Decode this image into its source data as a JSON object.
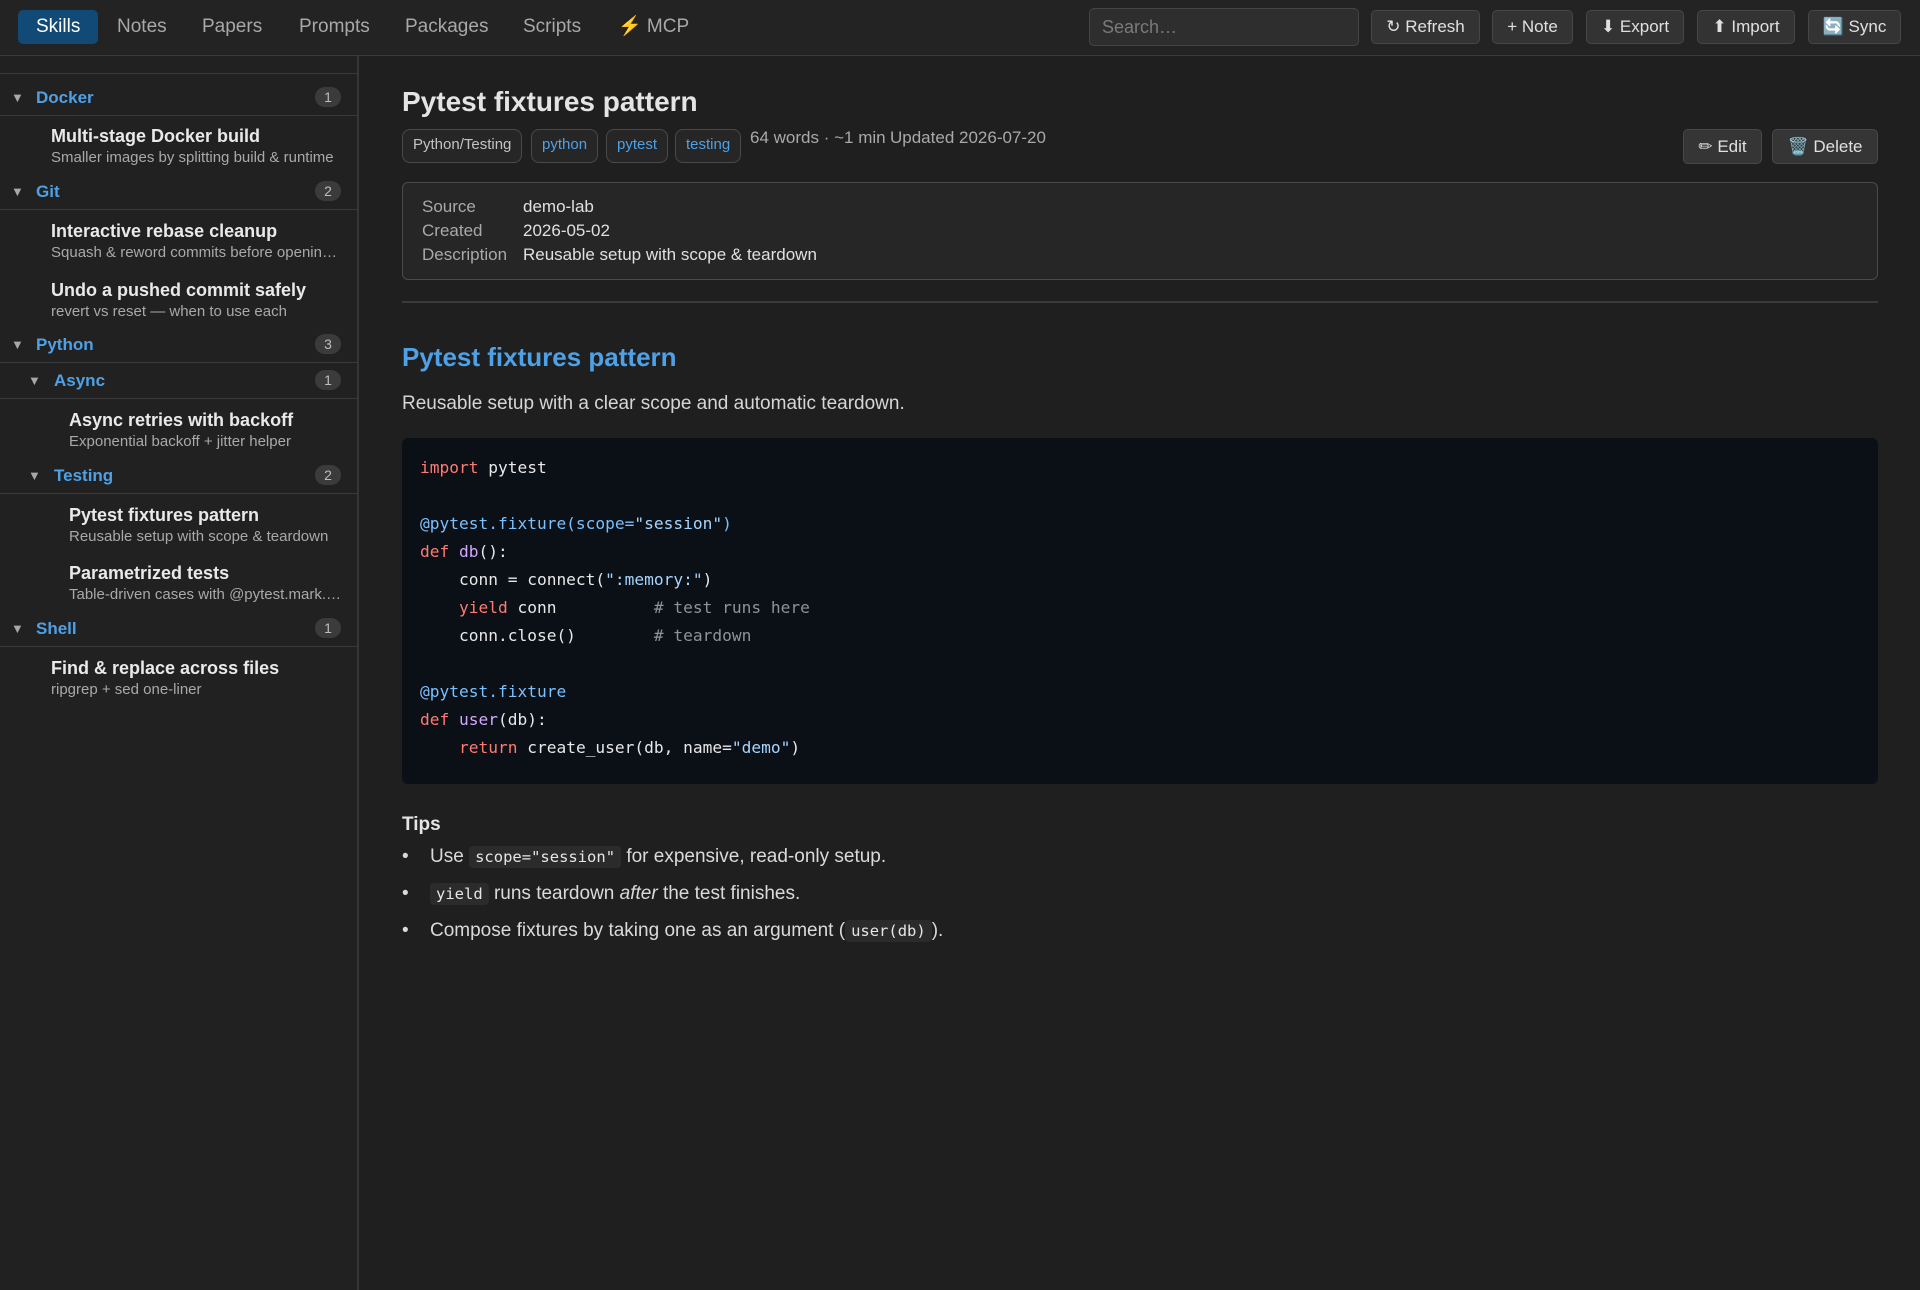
{
  "nav": {
    "tabs": [
      {
        "label": "Skills",
        "active": true
      },
      {
        "label": "Notes",
        "active": false
      },
      {
        "label": "Papers",
        "active": false
      },
      {
        "label": "Prompts",
        "active": false
      },
      {
        "label": "Packages",
        "active": false
      },
      {
        "label": "Scripts",
        "active": false
      },
      {
        "label": "⚡ MCP",
        "active": false
      }
    ],
    "search_placeholder": "Search…",
    "actions": {
      "refresh": "↻ Refresh",
      "note": "+ Note",
      "export": "⬇ Export",
      "import": "⬆ Import",
      "sync": "🔄 Sync"
    }
  },
  "sidebar": {
    "groups": {
      "docker": {
        "name": "Docker",
        "count": "1"
      },
      "git": {
        "name": "Git",
        "count": "2"
      },
      "python": {
        "name": "Python",
        "count": "3"
      },
      "async": {
        "name": "Async",
        "count": "1"
      },
      "testing": {
        "name": "Testing",
        "count": "2"
      },
      "shell": {
        "name": "Shell",
        "count": "1"
      }
    },
    "items": {
      "docker_build": {
        "title": "Multi-stage Docker build",
        "subtitle": "Smaller images by splitting build & runtime"
      },
      "rebase": {
        "title": "Interactive rebase cleanup",
        "subtitle": "Squash & reword commits before opening a PR"
      },
      "undo_commit": {
        "title": "Undo a pushed commit safely",
        "subtitle": "revert vs reset — when to use each"
      },
      "async_retries": {
        "title": "Async retries with backoff",
        "subtitle": "Exponential backoff + jitter helper"
      },
      "pytest_fixtures": {
        "title": "Pytest fixtures pattern",
        "subtitle": "Reusable setup with scope & teardown"
      },
      "parametrized": {
        "title": "Parametrized tests",
        "subtitle": "Table-driven cases with @pytest.mark.parametrize"
      },
      "find_replace": {
        "title": "Find & replace across files",
        "subtitle": "ripgrep + sed one-liner"
      }
    }
  },
  "detail": {
    "title": "Pytest fixtures pattern",
    "category": "Python/Testing",
    "tags": [
      "python",
      "pytest",
      "testing"
    ],
    "meta_stats": "64 words · ~1 min",
    "updated": "Updated 2026-07-20",
    "edit_label": "✏ Edit",
    "delete_label": "🗑️ Delete",
    "info": {
      "source_label": "Source",
      "source": "demo-lab",
      "created_label": "Created",
      "created": "2026-05-02",
      "description_label": "Description",
      "description": "Reusable setup with scope & teardown"
    },
    "doc": {
      "heading": "Pytest fixtures pattern",
      "intro": "Reusable setup with a clear scope and automatic teardown.",
      "code": {
        "l1_kw": "import",
        "l1_rest": " pytest",
        "l3_dec": "@pytest.fixture(scope=",
        "l3_str": "\"session\"",
        "l3_end": ")",
        "l4_kw": "def",
        "l4_fn": "db",
        "l4_rest": "():",
        "l5_a": "    conn = connect(",
        "l5_str": "\":memory:\"",
        "l5_b": ")",
        "l6_kw": "    yield",
        "l6_rest": " conn          ",
        "l6_cm": "# test runs here",
        "l7_rest": "    conn.close()        ",
        "l7_cm": "# teardown",
        "l9_dec": "@pytest.fixture",
        "l10_kw": "def",
        "l10_fn": "user",
        "l10_rest": "(db):",
        "l11_kw": "    return",
        "l11_a": " create_user(db, name=",
        "l11_str": "\"demo\"",
        "l11_b": ")"
      },
      "tips_heading": "Tips",
      "tips": {
        "t1_a": "Use ",
        "t1_code": "scope=\"session\"",
        "t1_b": " for expensive, read-only setup.",
        "t2_code": "yield",
        "t2_a": " runs teardown ",
        "t2_em": "after",
        "t2_b": " the test finishes.",
        "t3_a": "Compose fixtures by taking one as an argument (",
        "t3_code": "user(db)",
        "t3_b": ")."
      }
    }
  }
}
